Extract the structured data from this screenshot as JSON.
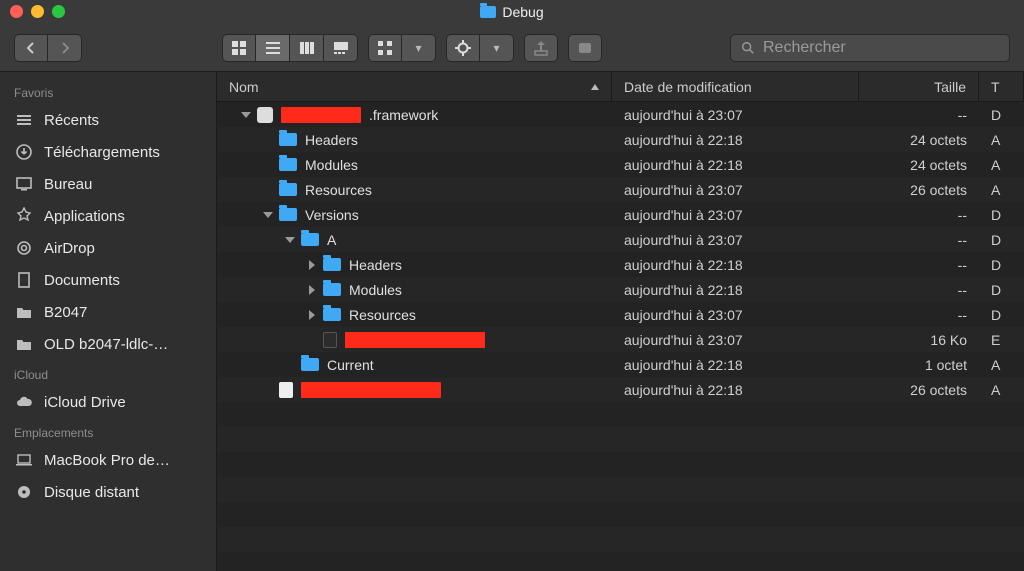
{
  "window": {
    "title": "Debug"
  },
  "search": {
    "placeholder": "Rechercher"
  },
  "sidebar": {
    "sections": [
      {
        "label": "Favoris",
        "items": [
          {
            "icon": "recents",
            "label": "Récents"
          },
          {
            "icon": "download",
            "label": "Téléchargements"
          },
          {
            "icon": "desktop",
            "label": "Bureau"
          },
          {
            "icon": "apps",
            "label": "Applications"
          },
          {
            "icon": "airdrop",
            "label": "AirDrop"
          },
          {
            "icon": "documents",
            "label": "Documents"
          },
          {
            "icon": "folder",
            "label": "B2047"
          },
          {
            "icon": "folder",
            "label": "OLD b2047-ldlc-…"
          }
        ]
      },
      {
        "label": "iCloud",
        "items": [
          {
            "icon": "cloud",
            "label": "iCloud Drive"
          }
        ]
      },
      {
        "label": "Emplacements",
        "items": [
          {
            "icon": "laptop",
            "label": "MacBook Pro de…"
          },
          {
            "icon": "disc",
            "label": "Disque distant"
          }
        ]
      }
    ]
  },
  "columns": {
    "name": "Nom",
    "date": "Date de modification",
    "size": "Taille",
    "kind": "T"
  },
  "rows": [
    {
      "depth": 0,
      "disclosure": "open",
      "icon": "lego",
      "name_pre": "",
      "name_post": ".framework",
      "redact_w": 80,
      "date": "aujourd'hui à 23:07",
      "size": "--",
      "kind": "D"
    },
    {
      "depth": 1,
      "disclosure": "none",
      "icon": "folder",
      "name": "Headers",
      "date": "aujourd'hui à 22:18",
      "size": "24 octets",
      "kind": "A"
    },
    {
      "depth": 1,
      "disclosure": "none",
      "icon": "folder",
      "name": "Modules",
      "date": "aujourd'hui à 22:18",
      "size": "24 octets",
      "kind": "A"
    },
    {
      "depth": 1,
      "disclosure": "none",
      "icon": "folder",
      "name": "Resources",
      "date": "aujourd'hui à 23:07",
      "size": "26 octets",
      "kind": "A"
    },
    {
      "depth": 1,
      "disclosure": "open",
      "icon": "folder",
      "name": "Versions",
      "date": "aujourd'hui à 23:07",
      "size": "--",
      "kind": "D"
    },
    {
      "depth": 2,
      "disclosure": "open",
      "icon": "folder",
      "name": "A",
      "date": "aujourd'hui à 23:07",
      "size": "--",
      "kind": "D"
    },
    {
      "depth": 3,
      "disclosure": "closed",
      "icon": "folder",
      "name": "Headers",
      "date": "aujourd'hui à 22:18",
      "size": "--",
      "kind": "D"
    },
    {
      "depth": 3,
      "disclosure": "closed",
      "icon": "folder",
      "name": "Modules",
      "date": "aujourd'hui à 22:18",
      "size": "--",
      "kind": "D"
    },
    {
      "depth": 3,
      "disclosure": "closed",
      "icon": "folder",
      "name": "Resources",
      "date": "aujourd'hui à 23:07",
      "size": "--",
      "kind": "D"
    },
    {
      "depth": 3,
      "disclosure": "none",
      "icon": "exec",
      "redact_w": 140,
      "date": "aujourd'hui à 23:07",
      "size": "16 Ko",
      "kind": "E"
    },
    {
      "depth": 2,
      "disclosure": "none",
      "icon": "folder",
      "name": "Current",
      "date": "aujourd'hui à 22:18",
      "size": "1 octet",
      "kind": "A"
    },
    {
      "depth": 1,
      "disclosure": "none",
      "icon": "file",
      "redact_w": 140,
      "date": "aujourd'hui à 22:18",
      "size": "26 octets",
      "kind": "A"
    }
  ]
}
